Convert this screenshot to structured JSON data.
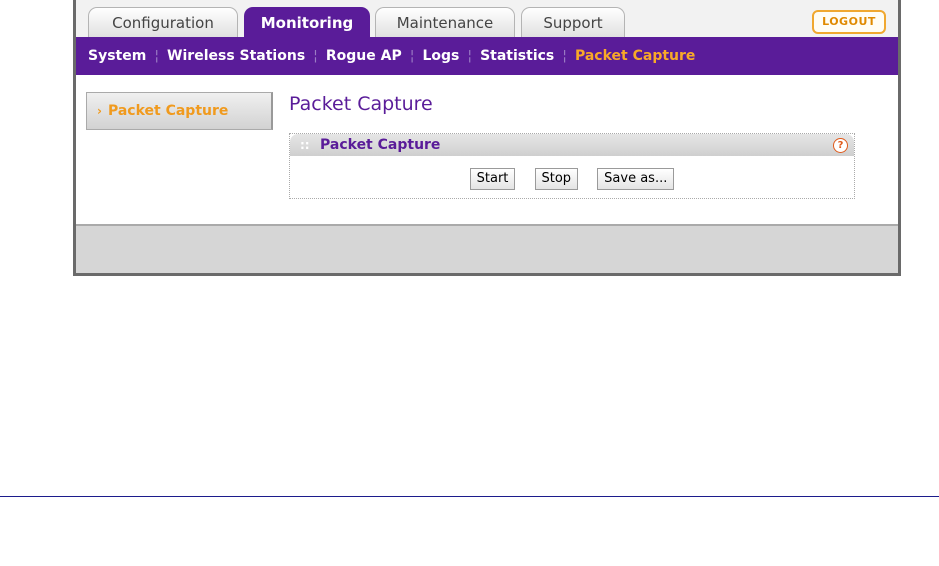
{
  "tabs": {
    "configuration": "Configuration",
    "monitoring": "Monitoring",
    "maintenance": "Maintenance",
    "support": "Support",
    "logout": "LOGOUT"
  },
  "subnav": {
    "system": "System",
    "wireless_stations": "Wireless Stations",
    "rogue_ap": "Rogue AP",
    "logs": "Logs",
    "statistics": "Statistics",
    "packet_capture": "Packet Capture"
  },
  "sidebar": {
    "packet_capture": "Packet Capture"
  },
  "main": {
    "page_title": "Packet Capture",
    "panel_title": "Packet Capture",
    "help_glyph": "?",
    "start_label": "Start",
    "stop_label": "Stop",
    "save_label": "Save as..."
  },
  "colors": {
    "brand": "#5a1c99",
    "accent": "#f8a928",
    "help": "#e05a1a"
  },
  "icons": [
    "chevron-right-icon",
    "grip-icon",
    "help-icon"
  ]
}
